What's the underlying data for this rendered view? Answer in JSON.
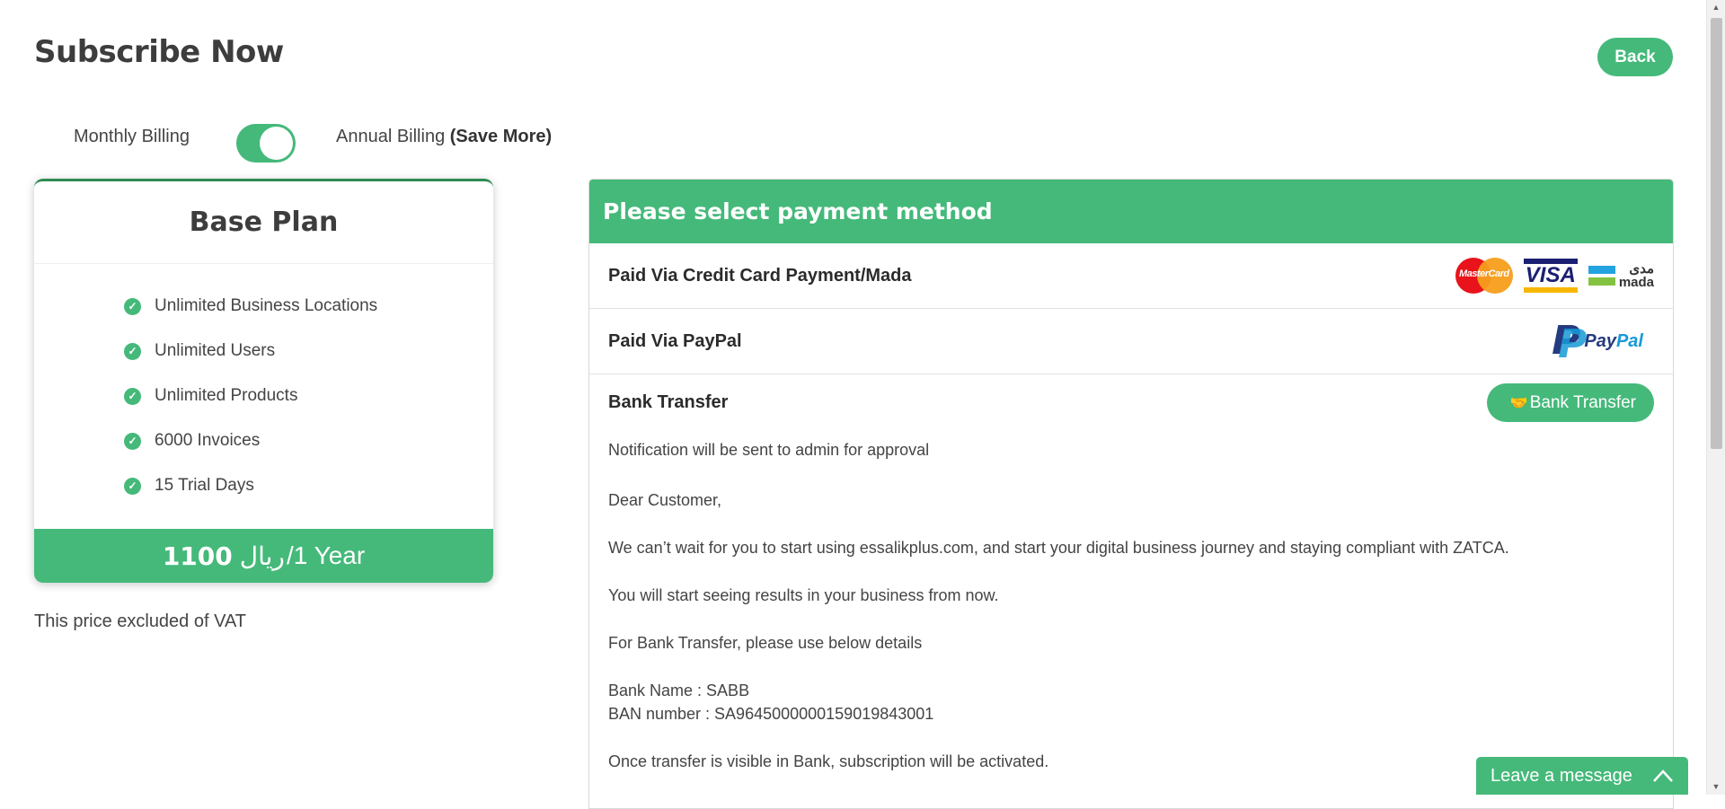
{
  "page": {
    "title": "Subscribe Now",
    "back_label": "Back"
  },
  "billing": {
    "monthly_label": "Monthly Billing",
    "annual_label": "Annual Billing",
    "annual_note": "(Save More)",
    "selected": "annual"
  },
  "plan": {
    "name": "Base Plan",
    "features": [
      "Unlimited Business Locations",
      "Unlimited Users",
      "Unlimited Products",
      "6000 Invoices",
      "15 Trial Days"
    ],
    "price_amount": "1100",
    "price_currency": "ريال",
    "price_period": "/1 Year",
    "vat_note": "This price excluded of VAT"
  },
  "payment": {
    "header": "Please select payment method",
    "options": [
      {
        "label": "Paid Via Credit Card Payment/Mada",
        "logos": [
          "mastercard",
          "visa",
          "mada"
        ]
      },
      {
        "label": "Paid Via PayPal",
        "logos": [
          "paypal"
        ]
      }
    ],
    "logos": {
      "mastercard_text": "MasterCard",
      "visa_text": "VISA",
      "mada_ar": "مدى",
      "mada_en": "mada",
      "paypal_pay": "Pay",
      "paypal_pal": "Pal"
    },
    "bank": {
      "title": "Bank Transfer",
      "button_label": "Bank Transfer",
      "button_icon": "handshake-icon",
      "notification": "Notification will be sent to admin for approval",
      "greeting": "Dear Customer,",
      "line1": "We can’t wait for you to start using essalikplus.com, and start your digital business journey and staying compliant with ZATCA.",
      "line2": "You will start seeing results in your business from now.",
      "line3": "For Bank Transfer, please use below details",
      "bank_name": "Bank Name : SABB",
      "ban_number": "BAN number : SA9645000000159019843001",
      "line4": "Once transfer is visible in Bank, subscription will be activated."
    }
  },
  "chat": {
    "label": "Leave a message",
    "icon": "chevron-up-icon"
  },
  "colors": {
    "accent": "#45b97a",
    "accent_dark": "#2e8b52",
    "text": "#3d3d3d"
  }
}
